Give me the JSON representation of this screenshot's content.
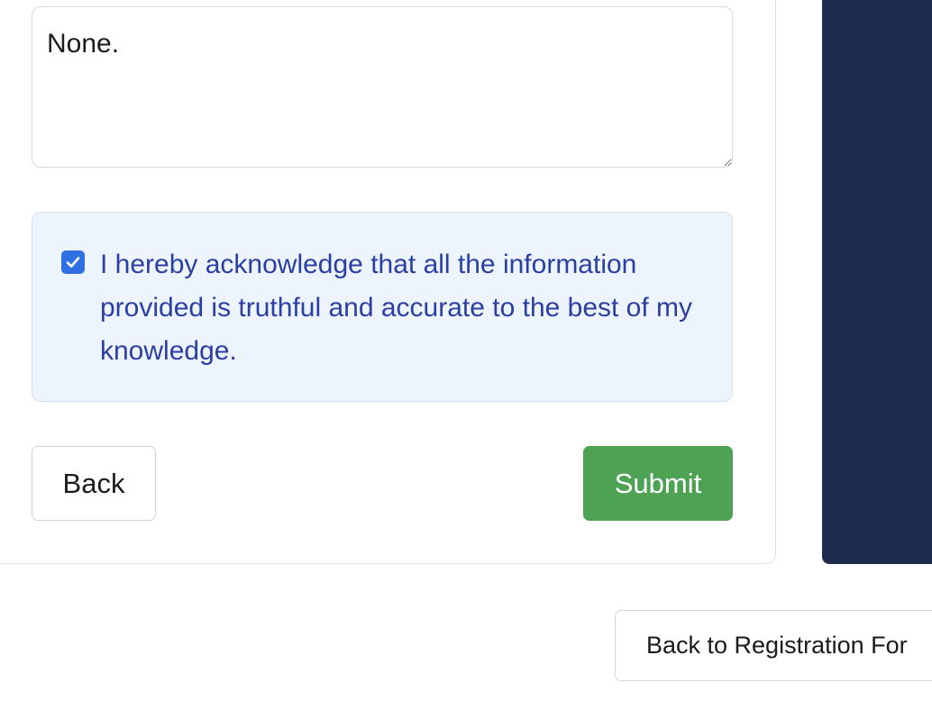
{
  "form": {
    "notes_value": "None.",
    "acknowledgement": {
      "checked": true,
      "text": "I hereby acknowledge that all the information provided is truthful and accurate to the best of my knowledge."
    },
    "back_label": "Back",
    "submit_label": "Submit"
  },
  "footer": {
    "back_to_registration_label": "Back to Registration For"
  },
  "colors": {
    "submit_green": "#4ea254",
    "ack_background": "#eef4fd",
    "ack_text": "#2b3fa3",
    "checkbox_blue": "#2f6fe4",
    "side_panel_navy": "#1f2b4d"
  }
}
